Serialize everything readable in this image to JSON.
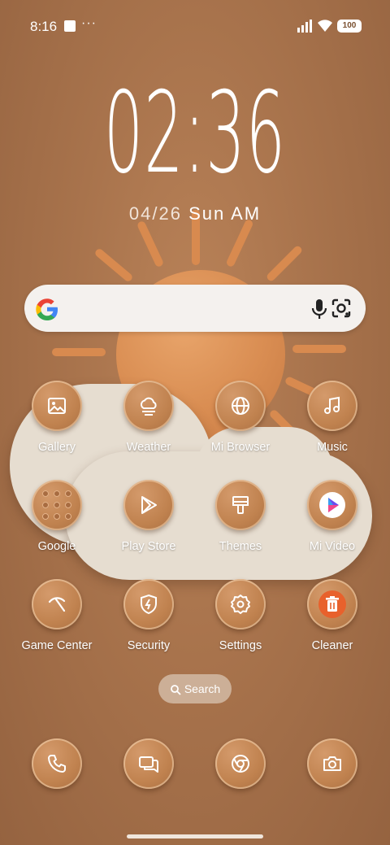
{
  "status": {
    "time": "8:16",
    "dots": "···",
    "battery": "100"
  },
  "clock": {
    "time": "02:36",
    "date": "04/26",
    "day": "Sun",
    "ampm": "AM"
  },
  "search_widget": {
    "mic_icon": "mic-icon",
    "lens_icon": "lens-icon"
  },
  "apps_row1": [
    {
      "label": "Gallery",
      "icon": "gallery-icon"
    },
    {
      "label": "Weather",
      "icon": "weather-icon"
    },
    {
      "label": "Mi Browser",
      "icon": "globe-icon"
    },
    {
      "label": "Music",
      "icon": "music-icon"
    }
  ],
  "apps_row2": [
    {
      "label": "Google",
      "icon": "folder-icon"
    },
    {
      "label": "Play Store",
      "icon": "play-store-icon"
    },
    {
      "label": "Themes",
      "icon": "brush-icon"
    },
    {
      "label": "Mi Video",
      "icon": "mi-video-icon"
    }
  ],
  "apps_row3": [
    {
      "label": "Game Center",
      "icon": "game-center-icon"
    },
    {
      "label": "Security",
      "icon": "security-shield-icon"
    },
    {
      "label": "Settings",
      "icon": "gear-icon"
    },
    {
      "label": "Cleaner",
      "icon": "trash-icon"
    }
  ],
  "search_pill": {
    "label": "Search"
  },
  "dock": [
    {
      "icon": "phone-icon"
    },
    {
      "icon": "messages-icon"
    },
    {
      "icon": "chrome-icon"
    },
    {
      "icon": "camera-icon"
    }
  ],
  "colors": {
    "background": "#a8734c",
    "sun": "#d98d52",
    "cloud": "#e6ddd0",
    "cleaner": "#e8612c"
  }
}
